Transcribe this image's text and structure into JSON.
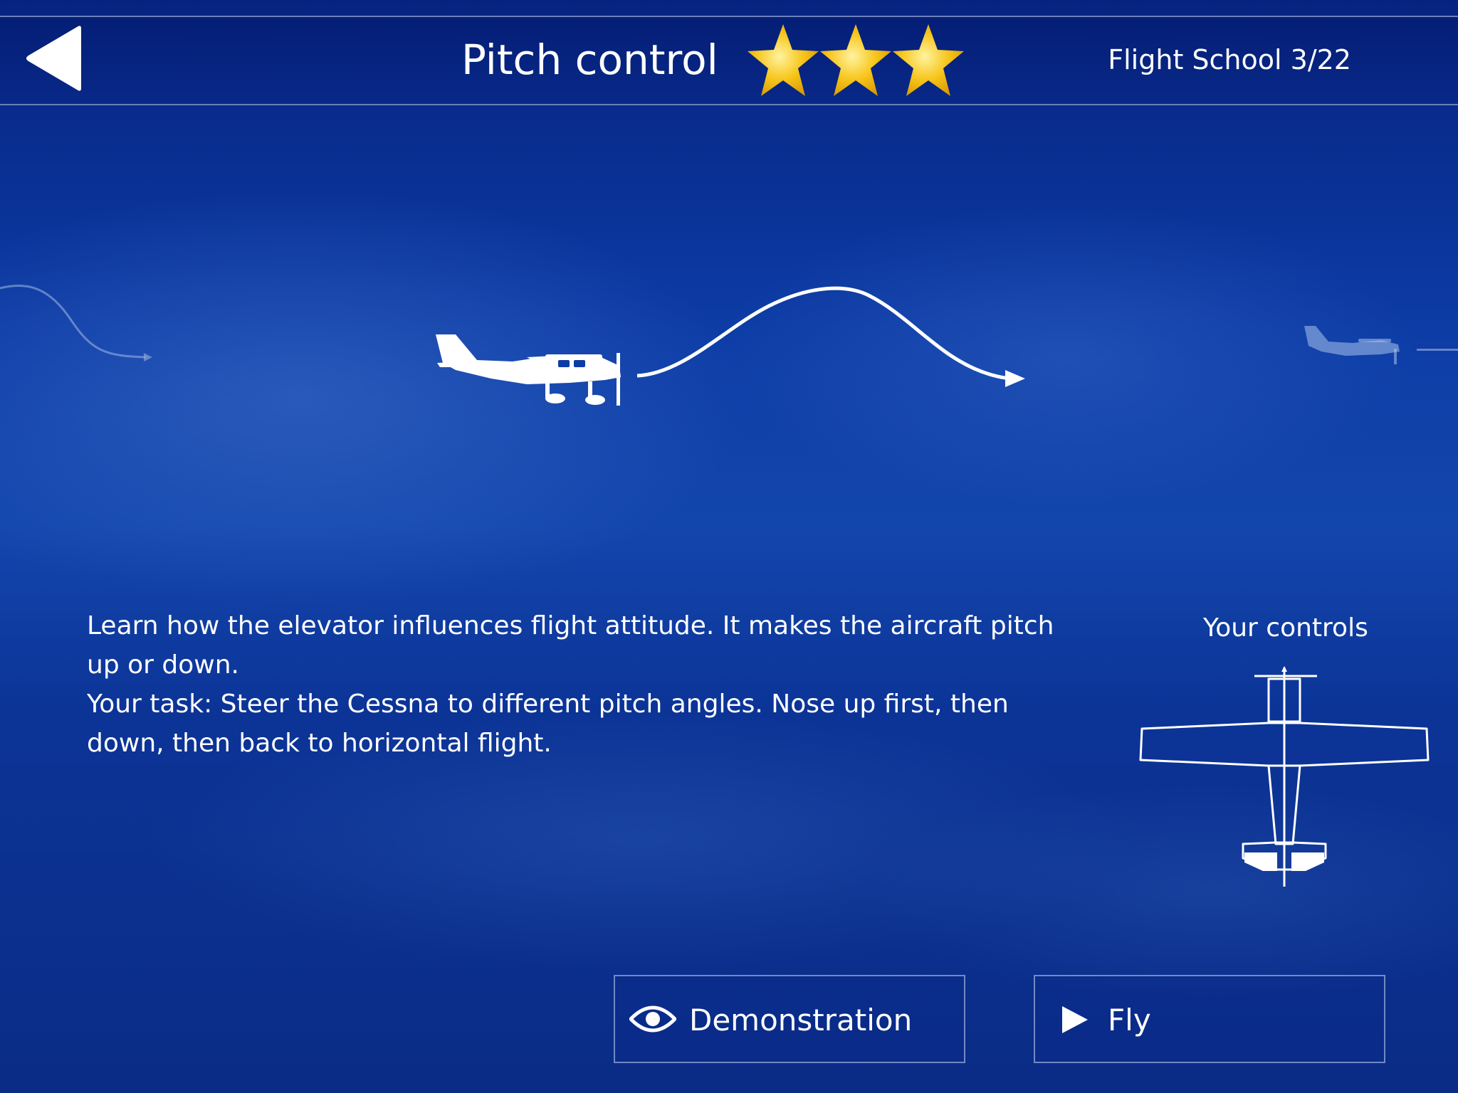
{
  "header": {
    "title": "Pitch control",
    "stars_earned": 3,
    "stars_total": 3,
    "progress": "Flight School 3/22",
    "back_icon": "back-arrow-icon"
  },
  "lesson": {
    "description_line1": "Learn how the elevator influences flight attitude. It makes the aircraft pitch up or down.",
    "description_line2": "Your task: Steer the Cessna to different pitch angles. Nose up first, then down, then back to horizontal flight.",
    "controls_label": "Your controls"
  },
  "actions": {
    "demonstration_label": "Demonstration",
    "demonstration_icon": "eye-icon",
    "fly_label": "Fly",
    "fly_icon": "play-icon"
  },
  "colors": {
    "star": "#f7c51a",
    "text": "#ffffff",
    "background": "#0d3ca6"
  }
}
